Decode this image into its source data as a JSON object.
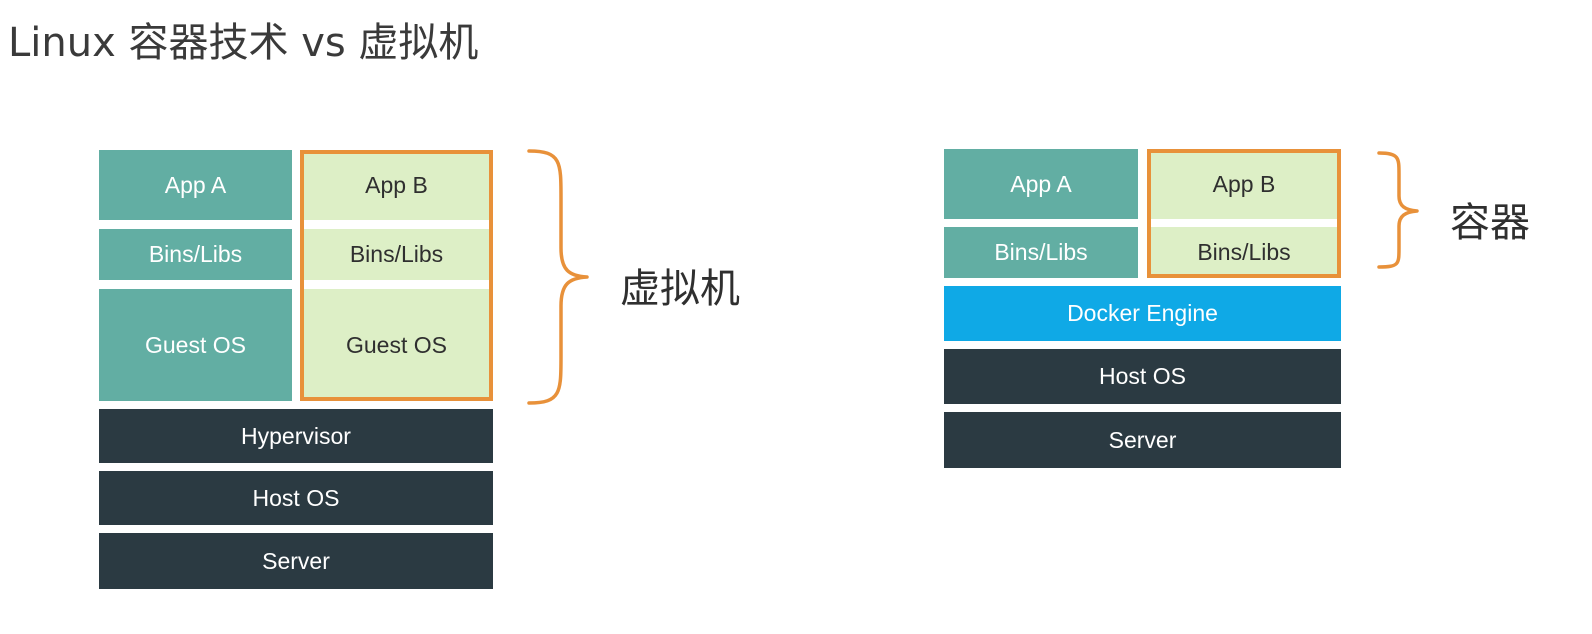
{
  "title": "Linux 容器技术 vs 虚拟机",
  "vm": {
    "app_a": "App A",
    "app_b": "App B",
    "bins_a": "Bins/Libs",
    "bins_b": "Bins/Libs",
    "guest_a": "Guest OS",
    "guest_b": "Guest OS",
    "hypervisor": "Hypervisor",
    "host_os": "Host OS",
    "server": "Server",
    "brace_label": "虚拟机"
  },
  "container": {
    "app_a": "App A",
    "app_b": "App B",
    "bins_a": "Bins/Libs",
    "bins_b": "Bins/Libs",
    "docker_engine": "Docker Engine",
    "host_os": "Host OS",
    "server": "Server",
    "brace_label": "容器"
  },
  "colors": {
    "teal": "#62aea3",
    "pale_green": "#ddefc6",
    "dark": "#2b3a42",
    "docker_blue": "#0fa9e6",
    "highlight_orange": "#e8913a"
  }
}
